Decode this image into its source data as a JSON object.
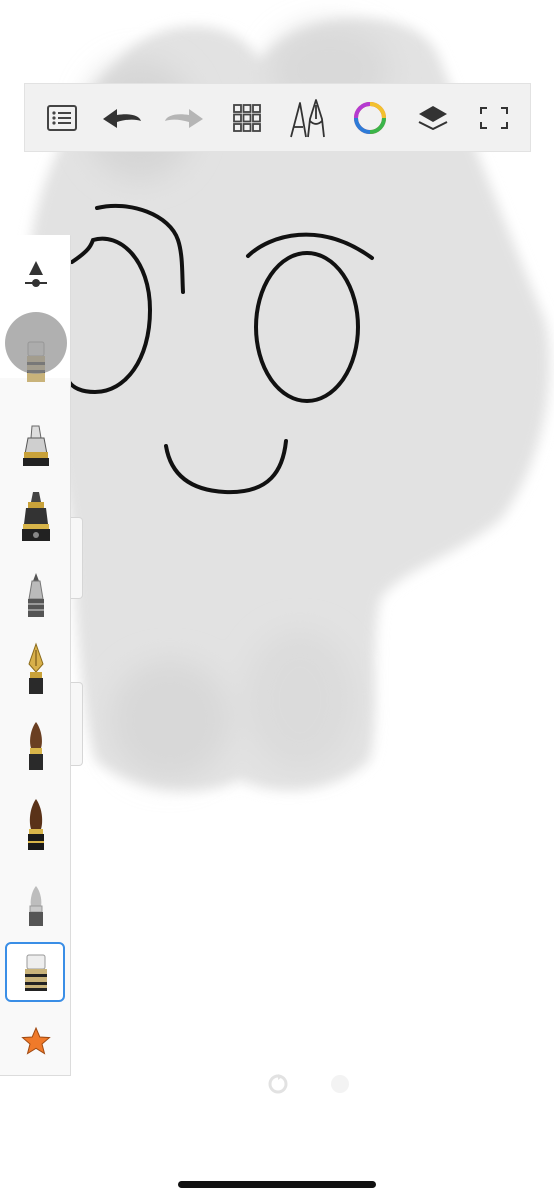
{
  "app": {
    "accent": "#3a8ee6",
    "favorite_color": "#f07a2a"
  },
  "toolbar": {
    "items": [
      {
        "name": "menu-list-icon"
      },
      {
        "name": "undo-icon"
      },
      {
        "name": "redo-icon",
        "state": "disabled"
      },
      {
        "name": "grid-icon"
      },
      {
        "name": "brush-library-icon"
      },
      {
        "name": "color-wheel-icon"
      },
      {
        "name": "layers-icon"
      },
      {
        "name": "fullscreen-icon"
      }
    ]
  },
  "brush_palette": {
    "brushes": [
      {
        "name": "eraser-brush-icon"
      },
      {
        "name": "marker-brush-icon"
      },
      {
        "name": "ink-pen-brush-icon"
      },
      {
        "name": "ballpoint-pen-brush-icon"
      },
      {
        "name": "fountain-pen-brush-icon"
      },
      {
        "name": "paint-brush-icon"
      },
      {
        "name": "ink-brush-icon"
      },
      {
        "name": "pencil-brush-icon"
      },
      {
        "name": "eraser-brush-icon",
        "selected": true
      },
      {
        "name": "favorites-star-icon"
      }
    ]
  }
}
